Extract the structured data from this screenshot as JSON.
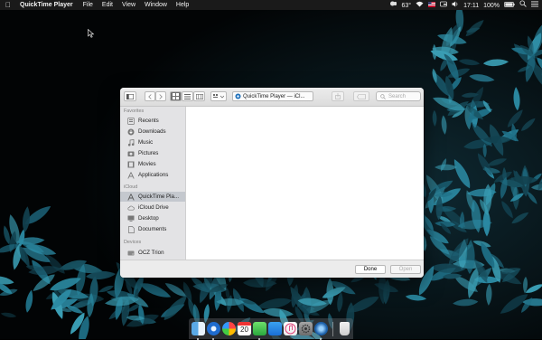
{
  "menubar": {
    "app_name": "QuickTime Player",
    "items": [
      "File",
      "Edit",
      "View",
      "Window",
      "Help"
    ],
    "temperature": "63°",
    "time": "17:11",
    "battery": "100%"
  },
  "dialog": {
    "path_label": "QuickTime Player — iCl...",
    "search_placeholder": "Search",
    "sidebar": {
      "favorites_header": "Favorites",
      "favorites": [
        {
          "label": "Recents",
          "icon": "recents-icon"
        },
        {
          "label": "Downloads",
          "icon": "downloads-icon"
        },
        {
          "label": "Music",
          "icon": "music-icon"
        },
        {
          "label": "Pictures",
          "icon": "pictures-icon"
        },
        {
          "label": "Movies",
          "icon": "movies-icon"
        },
        {
          "label": "Applications",
          "icon": "applications-icon"
        }
      ],
      "icloud_header": "iCloud",
      "icloud": [
        {
          "label": "QuickTime Pla...",
          "icon": "quicktime-folder-icon",
          "selected": true
        },
        {
          "label": "iCloud Drive",
          "icon": "icloud-icon"
        },
        {
          "label": "Desktop",
          "icon": "desktop-icon"
        },
        {
          "label": "Documents",
          "icon": "documents-icon"
        }
      ],
      "devices_header": "Devices",
      "devices": [
        {
          "label": "OCZ Trion",
          "icon": "disk-icon"
        }
      ]
    },
    "done_label": "Done",
    "open_label": "Open"
  },
  "dock": {
    "calendar_day": "20"
  },
  "colors": {
    "selection": "#c4c8ce",
    "sidebar_bg": "#e3e3e5",
    "menubar_bg": "#1a1a1a",
    "leaf": "#2f7c93"
  }
}
